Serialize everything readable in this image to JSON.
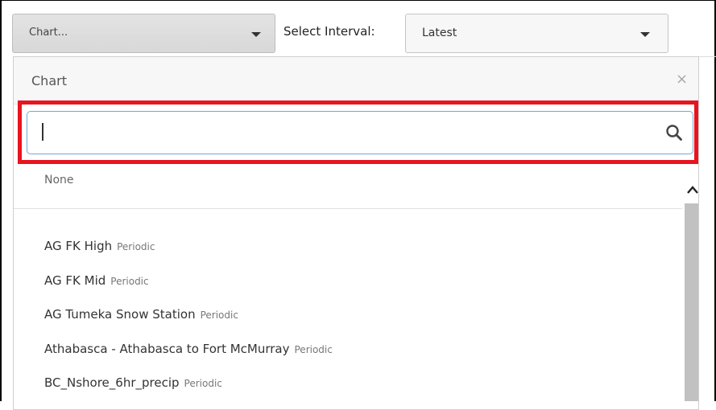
{
  "toolbar": {
    "chart_select": "Chart...",
    "interval_label": "Select Interval:",
    "interval_select": "Latest"
  },
  "panel": {
    "title": "Chart",
    "close_glyph": "×",
    "search": {
      "value": "",
      "placeholder": ""
    },
    "none_option": "None",
    "items": [
      {
        "name": "AG FK High",
        "tag": "Periodic"
      },
      {
        "name": "AG FK Mid",
        "tag": "Periodic"
      },
      {
        "name": "AG Tumeka Snow Station",
        "tag": "Periodic"
      },
      {
        "name": "Athabasca - Athabasca to Fort McMurray",
        "tag": "Periodic"
      },
      {
        "name": "BC_Nshore_6hr_precip",
        "tag": "Periodic"
      }
    ]
  },
  "colors": {
    "highlight": "#e8141f",
    "search_focus_border": "#6fa8dc"
  },
  "icons": [
    "chevron-down-icon",
    "close-icon",
    "search-icon",
    "scroll-up-icon"
  ]
}
